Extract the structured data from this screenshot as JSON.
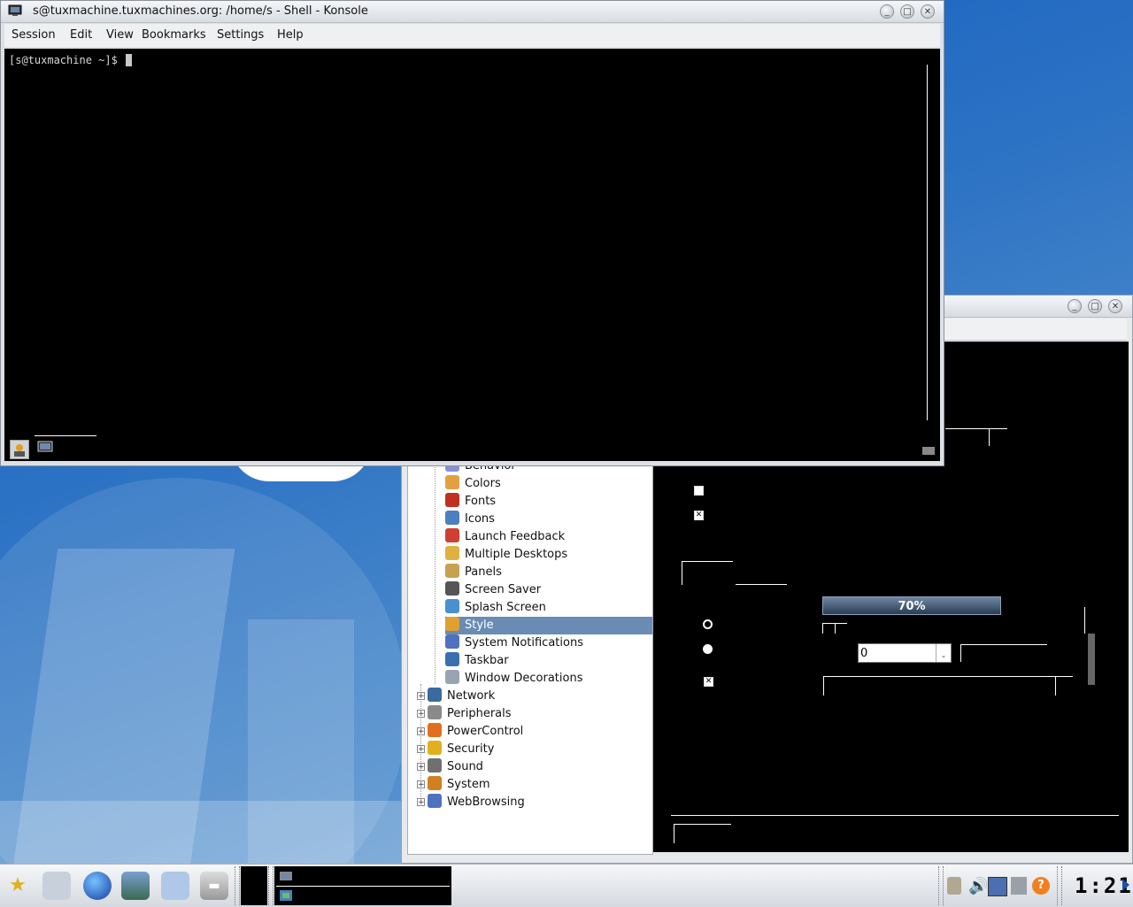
{
  "konsole": {
    "title": "s@tuxmachine.tuxmachines.org: /home/s - Shell - Konsole",
    "menu": [
      "Session",
      "Edit",
      "View",
      "Bookmarks",
      "Settings",
      "Help"
    ],
    "prompt": "[s@tuxmachine ~]$ "
  },
  "kcontrol": {
    "tree_items": [
      {
        "label": "Behavior",
        "icon": "behavior-icon",
        "color": "#8a8fd8"
      },
      {
        "label": "Colors",
        "icon": "colors-icon",
        "color": "#e4a040"
      },
      {
        "label": "Fonts",
        "icon": "fonts-icon",
        "color": "#c03020"
      },
      {
        "label": "Icons",
        "icon": "icons-icon",
        "color": "#4a80c0"
      },
      {
        "label": "Launch Feedback",
        "icon": "launch-feedback-icon",
        "color": "#d04030"
      },
      {
        "label": "Multiple Desktops",
        "icon": "multiple-desktops-icon",
        "color": "#e0b040"
      },
      {
        "label": "Panels",
        "icon": "panels-icon",
        "color": "#c8a050"
      },
      {
        "label": "Screen Saver",
        "icon": "screen-saver-icon",
        "color": "#555555"
      },
      {
        "label": "Splash Screen",
        "icon": "splash-screen-icon",
        "color": "#4a90d0"
      },
      {
        "label": "Style",
        "icon": "style-icon",
        "color": "#e0a030"
      },
      {
        "label": "System Notifications",
        "icon": "system-notifications-icon",
        "color": "#5070c0"
      },
      {
        "label": "Taskbar",
        "icon": "taskbar-icon",
        "color": "#3a70b0"
      },
      {
        "label": "Window Decorations",
        "icon": "window-decorations-icon",
        "color": "#9aa4b0"
      }
    ],
    "selected": "Style",
    "categories": [
      {
        "label": "Network",
        "icon": "network-icon",
        "color": "#3a6aa0"
      },
      {
        "label": "Peripherals",
        "icon": "peripherals-icon",
        "color": "#8a8a8a"
      },
      {
        "label": "PowerControl",
        "icon": "powercontrol-icon",
        "color": "#e07020"
      },
      {
        "label": "Security",
        "icon": "security-icon",
        "color": "#e0b020"
      },
      {
        "label": "Sound",
        "icon": "sound-icon",
        "color": "#707070"
      },
      {
        "label": "System",
        "icon": "system-icon",
        "color": "#d08020"
      },
      {
        "label": "WebBrowsing",
        "icon": "webbrowsing-icon",
        "color": "#5070c0"
      }
    ],
    "progress_label": "70%",
    "progress_value": 70,
    "spin_value": "0"
  },
  "taskbar": {
    "clock": "1:21"
  }
}
